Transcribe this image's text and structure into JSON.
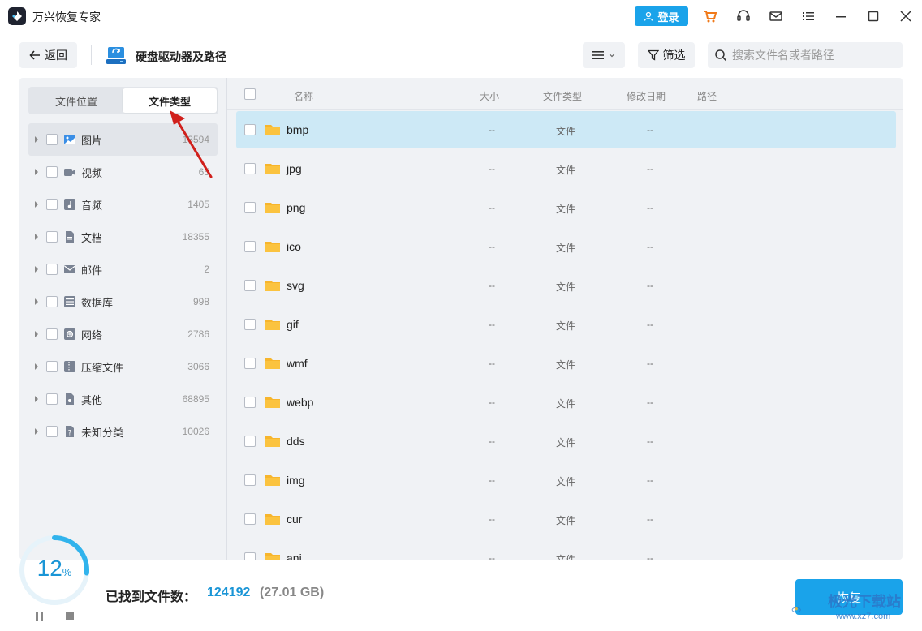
{
  "app": {
    "title": "万兴恢复专家",
    "login_label": "登录"
  },
  "toolbar": {
    "back_label": "返回",
    "location_title": "硬盘驱动器及路径",
    "filter_label": "筛选",
    "search_placeholder": "搜索文件名或者路径"
  },
  "sidebar": {
    "tabs": [
      {
        "label": "文件位置",
        "active": false
      },
      {
        "label": "文件类型",
        "active": true
      }
    ],
    "categories": [
      {
        "label": "图片",
        "count": "13594",
        "icon": "image-icon"
      },
      {
        "label": "视频",
        "count": "65",
        "icon": "video-icon"
      },
      {
        "label": "音频",
        "count": "1405",
        "icon": "audio-icon"
      },
      {
        "label": "文档",
        "count": "18355",
        "icon": "document-icon"
      },
      {
        "label": "邮件",
        "count": "2",
        "icon": "mail-icon"
      },
      {
        "label": "数据库",
        "count": "998",
        "icon": "database-icon"
      },
      {
        "label": "网络",
        "count": "2786",
        "icon": "network-icon"
      },
      {
        "label": "压缩文件",
        "count": "3066",
        "icon": "archive-icon"
      },
      {
        "label": "其他",
        "count": "68895",
        "icon": "other-icon"
      },
      {
        "label": "未知分类",
        "count": "10026",
        "icon": "unknown-icon"
      }
    ]
  },
  "table": {
    "columns": {
      "name": "名称",
      "size": "大小",
      "type": "文件类型",
      "modified": "修改日期",
      "path": "路径"
    },
    "rows": [
      {
        "name": "bmp",
        "size": "--",
        "type": "文件",
        "modified": "--"
      },
      {
        "name": "jpg",
        "size": "--",
        "type": "文件",
        "modified": "--"
      },
      {
        "name": "png",
        "size": "--",
        "type": "文件",
        "modified": "--"
      },
      {
        "name": "ico",
        "size": "--",
        "type": "文件",
        "modified": "--"
      },
      {
        "name": "svg",
        "size": "--",
        "type": "文件",
        "modified": "--"
      },
      {
        "name": "gif",
        "size": "--",
        "type": "文件",
        "modified": "--"
      },
      {
        "name": "wmf",
        "size": "--",
        "type": "文件",
        "modified": "--"
      },
      {
        "name": "webp",
        "size": "--",
        "type": "文件",
        "modified": "--"
      },
      {
        "name": "dds",
        "size": "--",
        "type": "文件",
        "modified": "--"
      },
      {
        "name": "img",
        "size": "--",
        "type": "文件",
        "modified": "--"
      },
      {
        "name": "cur",
        "size": "--",
        "type": "文件",
        "modified": "--"
      },
      {
        "name": "ani",
        "size": "--",
        "type": "文件",
        "modified": "--"
      }
    ]
  },
  "footer": {
    "progress_percent": "12",
    "progress_unit": "%",
    "found_label": "已找到文件数：",
    "found_count": "124192",
    "found_size": "(27.01 GB)",
    "recover_label": "恢复"
  },
  "watermark": {
    "text": "极光下载站",
    "url": "www.xz7.com"
  },
  "colors": {
    "accent": "#1aa3ea",
    "selected_row": "#cde9f6",
    "panel_bg": "#f0f2f5",
    "folder": "#f7b52c",
    "annotation_arrow": "#d0201c"
  }
}
